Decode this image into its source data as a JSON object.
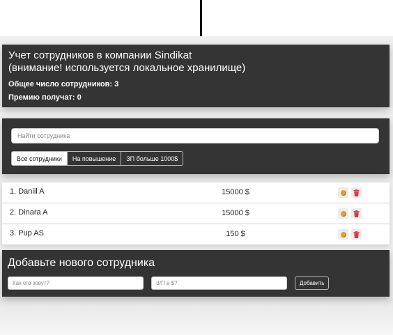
{
  "app_info": {
    "title_line1": "Учет сотрудников в компании Sindikat",
    "title_line2": "(внимание! используется локальное хранилище)",
    "total_employees": "Общее число сотрудников: 3",
    "bonus_recipients": "Премию получат: 0"
  },
  "search": {
    "placeholder": "Найти сотрудника"
  },
  "filters": [
    {
      "label": "Все сотрудники",
      "active": true
    },
    {
      "label": "На повышение",
      "active": false
    },
    {
      "label": "ЗП больше 1000$",
      "active": false
    }
  ],
  "employees": [
    {
      "name": "1. Daniil A",
      "salary": "15000 $"
    },
    {
      "name": "2. Dinara A",
      "salary": "15000 $"
    },
    {
      "name": "3. Pup AS",
      "salary": "150 $"
    }
  ],
  "add_form": {
    "title": "Добавьте нового сотрудника",
    "name_placeholder": "Как его зовут?",
    "salary_placeholder": "З/П в $?",
    "submit_label": "Добавить"
  },
  "colors": {
    "panel_bg": "#343434",
    "page_bg": "#eeeeee",
    "cookie": "#e0a030",
    "trash": "#dc3545"
  },
  "icons": [
    "cookie-icon",
    "trash-icon"
  ]
}
